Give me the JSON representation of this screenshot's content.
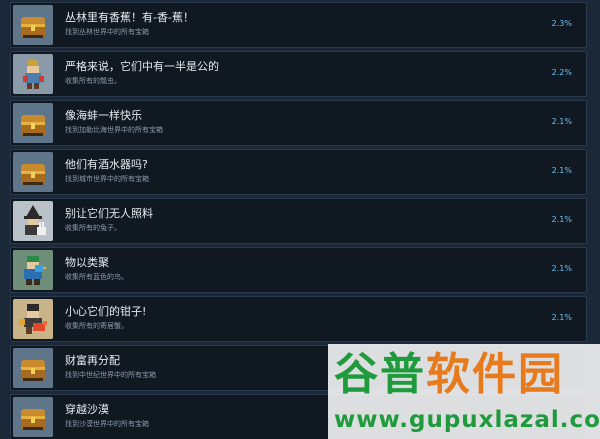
{
  "achievements": [
    {
      "title": "丛林里有香蕉！有-香-蕉！",
      "desc": "找到丛林世界中的所有宝箱",
      "percent": "2.3%",
      "icon": "treasure-chest-icon"
    },
    {
      "title": "严格来说，它们中有一半是公的",
      "desc": "收集所有的瓢虫。",
      "percent": "2.2%",
      "icon": "ladybug-collector-icon"
    },
    {
      "title": "像海蚌一样快乐",
      "desc": "找到加勒比海世界中的所有宝箱",
      "percent": "2.1%",
      "icon": "treasure-chest-icon"
    },
    {
      "title": "他们有酒水器吗?",
      "desc": "找到城市世界中的所有宝箱",
      "percent": "2.1%",
      "icon": "treasure-chest-icon"
    },
    {
      "title": "别让它们无人照料",
      "desc": "收集所有的兔子。",
      "percent": "2.1%",
      "icon": "witch-rabbit-icon"
    },
    {
      "title": "物以类聚",
      "desc": "收集所有蓝色的鸟。",
      "percent": "2.1%",
      "icon": "blue-bird-icon"
    },
    {
      "title": "小心它们的钳子!",
      "desc": "收集所有的寄居蟹。",
      "percent": "2.1%",
      "icon": "hermit-crab-icon"
    },
    {
      "title": "财富再分配",
      "desc": "找到中世纪世界中的所有宝箱",
      "percent": "",
      "icon": "treasure-chest-icon"
    },
    {
      "title": "穿越沙漠",
      "desc": "找到沙漠世界中的所有宝箱",
      "percent": "",
      "icon": "treasure-chest-icon"
    }
  ],
  "watermark": {
    "cn_green": "谷普",
    "cn_orange": "软件园",
    "url": "www.gupuxlazal.com"
  }
}
